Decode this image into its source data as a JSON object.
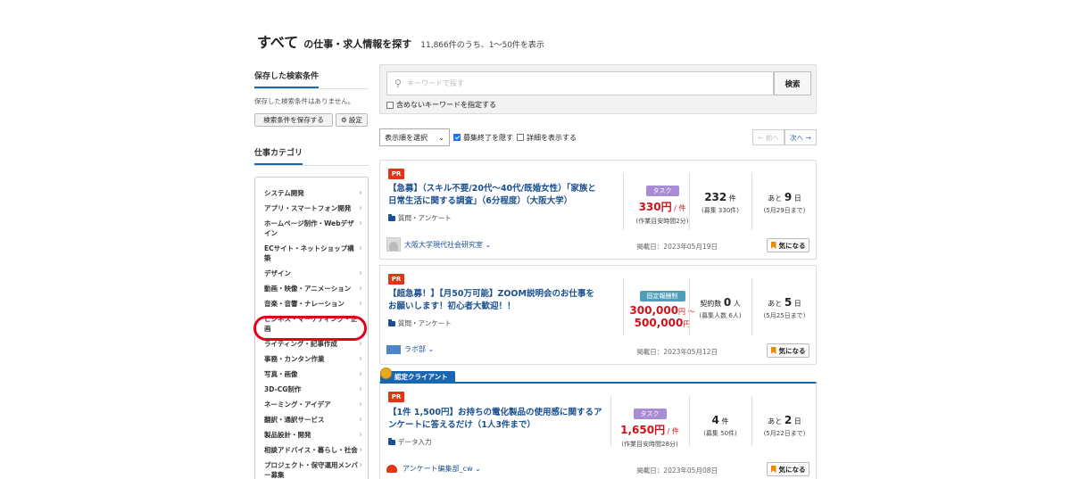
{
  "heading": {
    "category": "すべて",
    "suffix": "の仕事・求人情報を探す",
    "count": "11,866件のうち、1〜50件を表示"
  },
  "sidebar": {
    "saved_title": "保存した検索条件",
    "saved_empty": "保存した検索条件はありません。",
    "save_button": "検索条件を保存する",
    "settings_button": "設定",
    "category_title": "仕事カテゴリ",
    "categories": [
      "システム開発",
      "アプリ・スマートフォン開発",
      "ホームページ制作・Webデザイン",
      "ECサイト・ネットショップ構築",
      "デザイン",
      "動画・映像・アニメーション",
      "音楽・音響・ナレーション",
      "ビジネス・マーケティング・企画",
      "ライティング・記事作成",
      "事務・カンタン作業",
      "写真・画像",
      "3D-CG制作",
      "ネーミング・アイデア",
      "翻訳・通訳サービス",
      "製品設計・開発",
      "相談アドバイス・暮らし・社会",
      "プロジェクト・保守運用メンバー募集"
    ],
    "highlighted_category": "ライティング・記事作成"
  },
  "search": {
    "placeholder": "キーワードで探す",
    "button": "検索",
    "exclude_label": "含めないキーワードを指定する"
  },
  "controls": {
    "sort_label": "表示順を選択",
    "hide_closed_label": "募集終了を隠す",
    "hide_closed_checked": true,
    "show_details_label": "詳細を表示する",
    "show_details_checked": false,
    "prev": "← 前へ",
    "next": "次へ →"
  },
  "jobs": [
    {
      "pr": "PR",
      "title": "【急募】（スキル不要/20代〜40代/既婚女性）「家族と日常生活に関する調査」（6分程度）（大阪大学）",
      "category": "質問・アンケート",
      "type": "タスク",
      "price": "330円",
      "price_unit": " / 件",
      "price_note": "(作業目安時間2分)",
      "applicants": "232",
      "applicants_unit": " 件",
      "applicants_note": "(募集 330件)",
      "remain": "9",
      "remain_prefix": "あと ",
      "remain_unit": " 日",
      "deadline": "(5月29日まで)",
      "client": "大阪大学現代社会研究室 ⌄",
      "posted": "掲載日：2023年05月19日",
      "fav": "気になる"
    },
    {
      "pr": "PR",
      "title": "【超急募！】【月50万可能】ZOOM説明会のお仕事をお願いします！初心者大歓迎！！",
      "category": "質問・アンケート",
      "type": "固定報酬制",
      "price": "300,000",
      "price_unit_a": "円 〜",
      "price2": "500,000",
      "price_unit_b": "円",
      "applicants_prefix": "契約数 ",
      "applicants": "0",
      "applicants_unit": " 人",
      "applicants_note": "(募集人数 6人)",
      "remain": "5",
      "remain_prefix": "あと ",
      "remain_unit": " 日",
      "deadline": "(5月25日まで)",
      "client": "ラボ部 ⌄",
      "posted": "掲載日：2023年05月12日",
      "fav": "気になる"
    },
    {
      "cert": "認定クライアント",
      "pr": "PR",
      "title": "【1件 1,500円】お持ちの電化製品の使用感に関するアンケートに答えるだけ（1人3件まで）",
      "category": "データ入力",
      "type": "タスク",
      "price": "1,650円",
      "price_unit": " / 件",
      "price_note": "(作業目安時間28分)",
      "applicants": "4",
      "applicants_unit": " 件",
      "applicants_note": "(募集 50件)",
      "remain": "2",
      "remain_prefix": "あと ",
      "remain_unit": " 日",
      "deadline": "(5月22日まで)",
      "client": "アンケート編集部_cw ⌄",
      "posted": "掲載日：2023年05月08日",
      "fav": "気になる"
    }
  ],
  "colors": {
    "accent": "#1a66b0",
    "pr": "#e53316",
    "price": "#d0121b",
    "highlight_ring": "#e5001a"
  }
}
